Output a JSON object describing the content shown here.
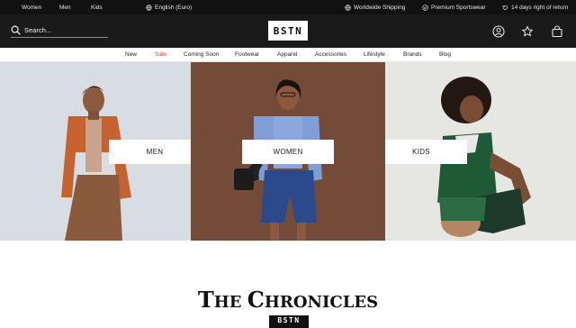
{
  "topbar": {
    "gender_links": [
      "Women",
      "Men",
      "Kids"
    ],
    "language": "English (Euro)",
    "shipping": "Worldwide Shipping",
    "premium": "Premium Sportswear",
    "returns": "14 days right of return"
  },
  "header": {
    "search_placeholder": "Search...",
    "logo": "BSTN"
  },
  "nav": {
    "items": [
      "New",
      "Sale",
      "Coming Soon",
      "Footwear",
      "Apparel",
      "Accessories",
      "Lifestyle",
      "Brands",
      "Blog"
    ]
  },
  "panels": {
    "men_label": "MEN",
    "women_label": "WOMEN",
    "kids_label": "KIDS"
  },
  "section": {
    "title_cap1": "T",
    "title_rest1": "HE ",
    "title_cap2": "C",
    "title_rest2": "HRONICLES",
    "sub_logo": "BSTN"
  },
  "colors": {
    "sale": "#e23a2e",
    "topbar": "#111111",
    "header": "#1a1a1a"
  }
}
